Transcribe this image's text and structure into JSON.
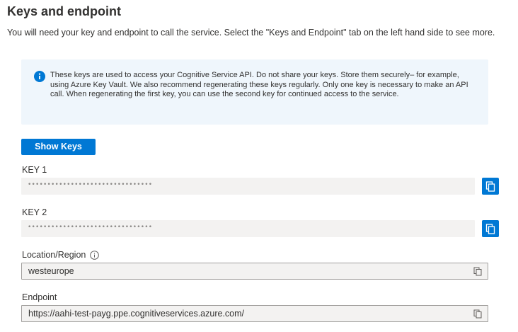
{
  "header": {
    "title": "Keys and endpoint",
    "subtitle": "You will need your key and endpoint to call the service. Select the \"Keys and Endpoint\" tab on the left hand side to see more."
  },
  "info_banner": {
    "icon": "info-icon",
    "text": "These keys are used to access your Cognitive Service API. Do not share your keys. Store them securely– for example, using Azure Key Vault. We also recommend regenerating these keys regularly. Only one key is necessary to make an API call. When regenerating the first key, you can use the second key for continued access to the service."
  },
  "show_keys": {
    "label": "Show Keys"
  },
  "key1": {
    "label": "KEY 1",
    "masked_value": "••••••••••••••••••••••••••••••••",
    "copy_icon": "copy-icon"
  },
  "key2": {
    "label": "KEY 2",
    "masked_value": "••••••••••••••••••••••••••••••••",
    "copy_icon": "copy-icon"
  },
  "location": {
    "label": "Location/Region",
    "value": "westeurope",
    "info_icon": "info-circle-icon",
    "copy_icon": "copy-icon"
  },
  "endpoint": {
    "label": "Endpoint",
    "value": "https://aahi-test-payg.ppe.cognitiveservices.azure.com/",
    "copy_icon": "copy-icon"
  },
  "colors": {
    "accent": "#0078d4",
    "info_background": "#eff6fc",
    "field_background": "#f3f2f1",
    "text": "#323130"
  }
}
